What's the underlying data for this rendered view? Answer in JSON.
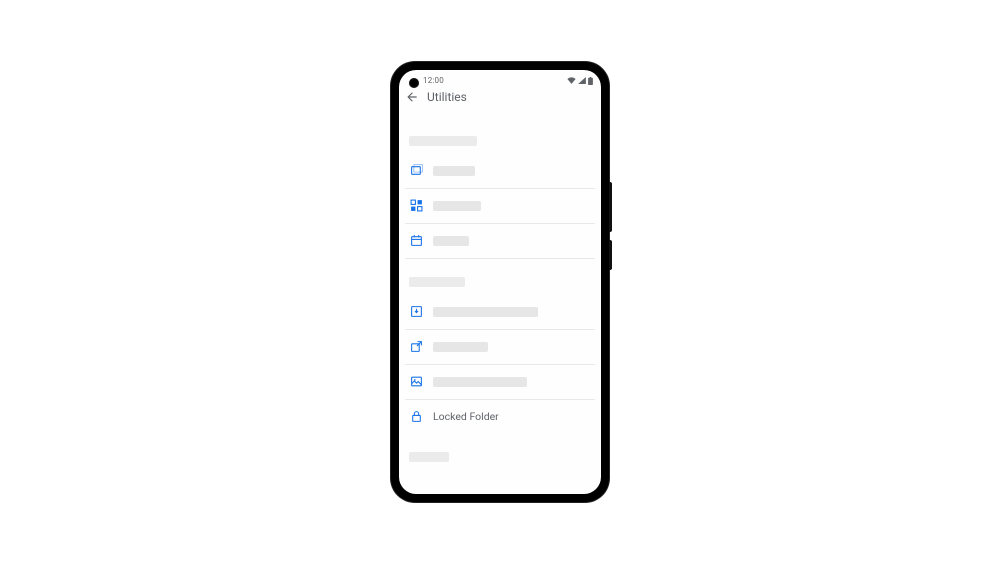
{
  "status": {
    "time": "12:00"
  },
  "header": {
    "title": "Utilities"
  },
  "items": {
    "locked_folder": "Locked Folder"
  },
  "colors": {
    "accent": "#1a73e8",
    "muted": "#5f6368",
    "placeholder": "#e6e6e6"
  }
}
